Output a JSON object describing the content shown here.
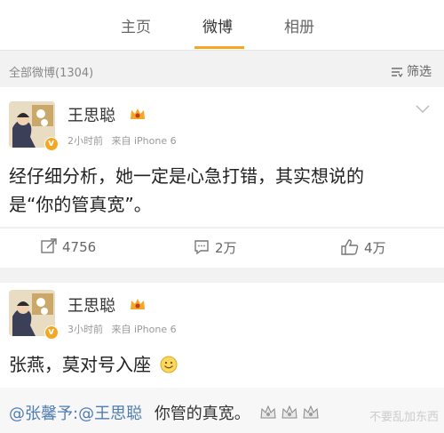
{
  "tabs": [
    {
      "label": "主页"
    },
    {
      "label": "微博"
    },
    {
      "label": "相册"
    }
  ],
  "filter_bar": {
    "total_text": "全部微博(1304)",
    "filter_label": "筛选"
  },
  "posts": [
    {
      "username": "王思聪",
      "time": "2小时前",
      "source": "来自 iPhone 6",
      "text_line1": "经仔细分析，她一定是心急打错，其实想说的",
      "text_line2": "是“你的管真宽”。",
      "actions": {
        "repost": "4756",
        "comment": "2万",
        "like": "4万"
      }
    },
    {
      "username": "王思聪",
      "time": "3小时前",
      "source": "来自 iPhone 6",
      "text": "张燕，莫对号入座"
    }
  ],
  "comment": {
    "mention1": "@张馨予",
    "sep": ":",
    "mention2": "@王思聪",
    "text": "你管的真宽。"
  },
  "watermark": "不要乱加东西",
  "colors": {
    "accent": "#f5a623",
    "link": "#507daf"
  }
}
